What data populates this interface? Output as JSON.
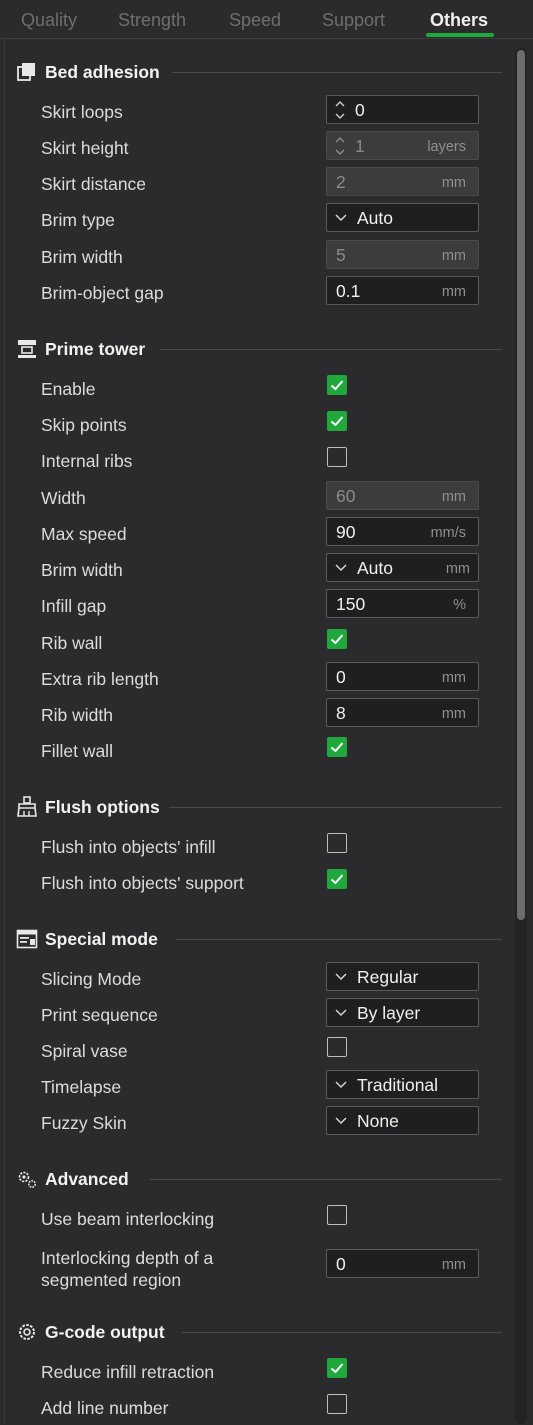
{
  "tabs": [
    "Quality",
    "Strength",
    "Speed",
    "Support",
    "Others"
  ],
  "active_tab": "Others",
  "accent_color": "#1fa83c",
  "sections": {
    "bed_adhesion": {
      "title": "Bed adhesion",
      "icon": "bed-adhesion-icon",
      "skirt_loops": {
        "label": "Skirt loops",
        "value": "0"
      },
      "skirt_height": {
        "label": "Skirt height",
        "value": "1",
        "unit": "layers"
      },
      "skirt_distance": {
        "label": "Skirt distance",
        "value": "2",
        "unit": "mm"
      },
      "brim_type": {
        "label": "Brim type",
        "value": "Auto"
      },
      "brim_width": {
        "label": "Brim width",
        "value": "5",
        "unit": "mm"
      },
      "brim_object_gap": {
        "label": "Brim-object gap",
        "value": "0.1",
        "unit": "mm"
      }
    },
    "prime_tower": {
      "title": "Prime tower",
      "icon": "prime-tower-icon",
      "enable": {
        "label": "Enable",
        "checked": true
      },
      "skip_points": {
        "label": "Skip points",
        "checked": true
      },
      "internal_ribs": {
        "label": "Internal ribs",
        "checked": false
      },
      "width": {
        "label": "Width",
        "value": "60",
        "unit": "mm"
      },
      "max_speed": {
        "label": "Max speed",
        "value": "90",
        "unit": "mm/s"
      },
      "brim_width": {
        "label": "Brim width",
        "value": "Auto",
        "unit": "mm"
      },
      "infill_gap": {
        "label": "Infill gap",
        "value": "150",
        "unit": "%"
      },
      "rib_wall": {
        "label": "Rib wall",
        "checked": true
      },
      "extra_rib_length": {
        "label": "Extra rib length",
        "value": "0",
        "unit": "mm"
      },
      "rib_width": {
        "label": "Rib width",
        "value": "8",
        "unit": "mm"
      },
      "fillet_wall": {
        "label": "Fillet wall",
        "checked": true
      }
    },
    "flush_options": {
      "title": "Flush options",
      "icon": "flush-brush-icon",
      "flush_infill": {
        "label": "Flush into objects' infill",
        "checked": false
      },
      "flush_support": {
        "label": "Flush into objects' support",
        "checked": true
      }
    },
    "special_mode": {
      "title": "Special mode",
      "icon": "special-mode-icon",
      "slicing_mode": {
        "label": "Slicing Mode",
        "value": "Regular"
      },
      "print_sequence": {
        "label": "Print sequence",
        "value": "By layer"
      },
      "spiral_vase": {
        "label": "Spiral vase",
        "checked": false
      },
      "timelapse": {
        "label": "Timelapse",
        "value": "Traditional"
      },
      "fuzzy_skin": {
        "label": "Fuzzy Skin",
        "value": "None"
      }
    },
    "advanced": {
      "title": "Advanced",
      "icon": "advanced-gears-icon",
      "beam_interlocking": {
        "label": "Use beam interlocking",
        "checked": false
      },
      "interlocking_depth": {
        "label": "Interlocking depth of a segmented region",
        "value": "0",
        "unit": "mm"
      }
    },
    "gcode_output": {
      "title": "G-code output",
      "icon": "gcode-gear-icon",
      "reduce_infill_retraction": {
        "label": "Reduce infill retraction",
        "checked": true
      },
      "add_line_number": {
        "label": "Add line number",
        "checked": false
      }
    }
  }
}
